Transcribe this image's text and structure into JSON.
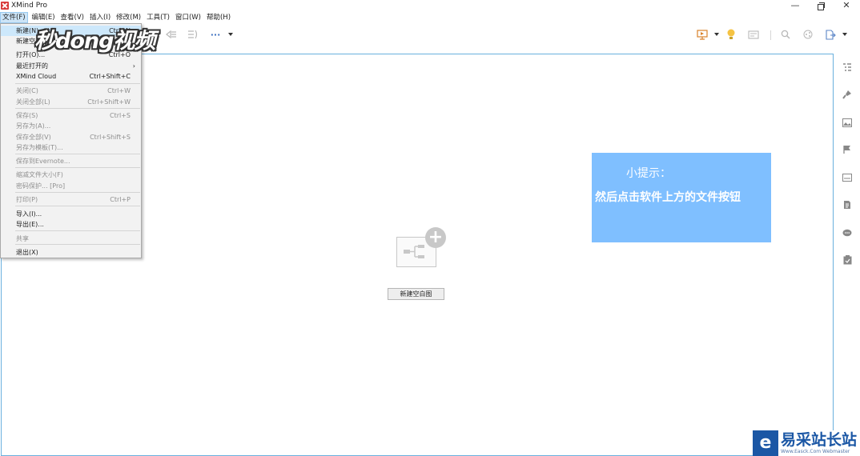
{
  "window": {
    "title": "XMind Pro",
    "controls": {
      "minimize": "—",
      "close": "✕"
    }
  },
  "menubar": {
    "items": [
      "文件(F)",
      "编辑(E)",
      "查看(V)",
      "插入(I)",
      "修改(M)",
      "工具(T)",
      "窗口(W)",
      "帮助(H)"
    ]
  },
  "toolbar": {
    "more": "···"
  },
  "file_menu": {
    "items": [
      {
        "label": "新建(N)",
        "shortcut": "Ctrl+N"
      },
      {
        "label": "新建空白图",
        "shortcut": ""
      },
      {
        "label": "打开(O)...",
        "shortcut": "Ctrl+O"
      },
      {
        "label": "最近打开的",
        "shortcut": "",
        "submenu": "›"
      },
      {
        "label": "XMind Cloud",
        "shortcut": "Ctrl+Shift+C"
      },
      {
        "label": "关闭(C)",
        "shortcut": "Ctrl+W"
      },
      {
        "label": "关闭全部(L)",
        "shortcut": "Ctrl+Shift+W"
      },
      {
        "label": "保存(S)",
        "shortcut": "Ctrl+S"
      },
      {
        "label": "另存为(A)...",
        "shortcut": ""
      },
      {
        "label": "保存全部(V)",
        "shortcut": "Ctrl+Shift+S"
      },
      {
        "label": "另存为模板(T)...",
        "shortcut": ""
      },
      {
        "label": "保存到Evernote...",
        "shortcut": ""
      },
      {
        "label": "缩减文件大小(F)",
        "shortcut": ""
      },
      {
        "label": "密码保护... [Pro]",
        "shortcut": ""
      },
      {
        "label": "打印(P)",
        "shortcut": "Ctrl+P"
      },
      {
        "label": "导入(I)...",
        "shortcut": ""
      },
      {
        "label": "导出(E)...",
        "shortcut": ""
      },
      {
        "label": "共享",
        "shortcut": ""
      },
      {
        "label": "退出(X)",
        "shortcut": ""
      }
    ]
  },
  "canvas": {
    "new_blank_button": "新建空白图"
  },
  "tip": {
    "title": "小提示：",
    "text": "然后点击软件上方的文件按钮"
  },
  "watermarks": {
    "top_left": "秒dong视频",
    "bottom_right": "易采站长站",
    "bottom_right_sub": "Www.Easck.Com  Webmaster",
    "bottom_right_logo": "e"
  }
}
